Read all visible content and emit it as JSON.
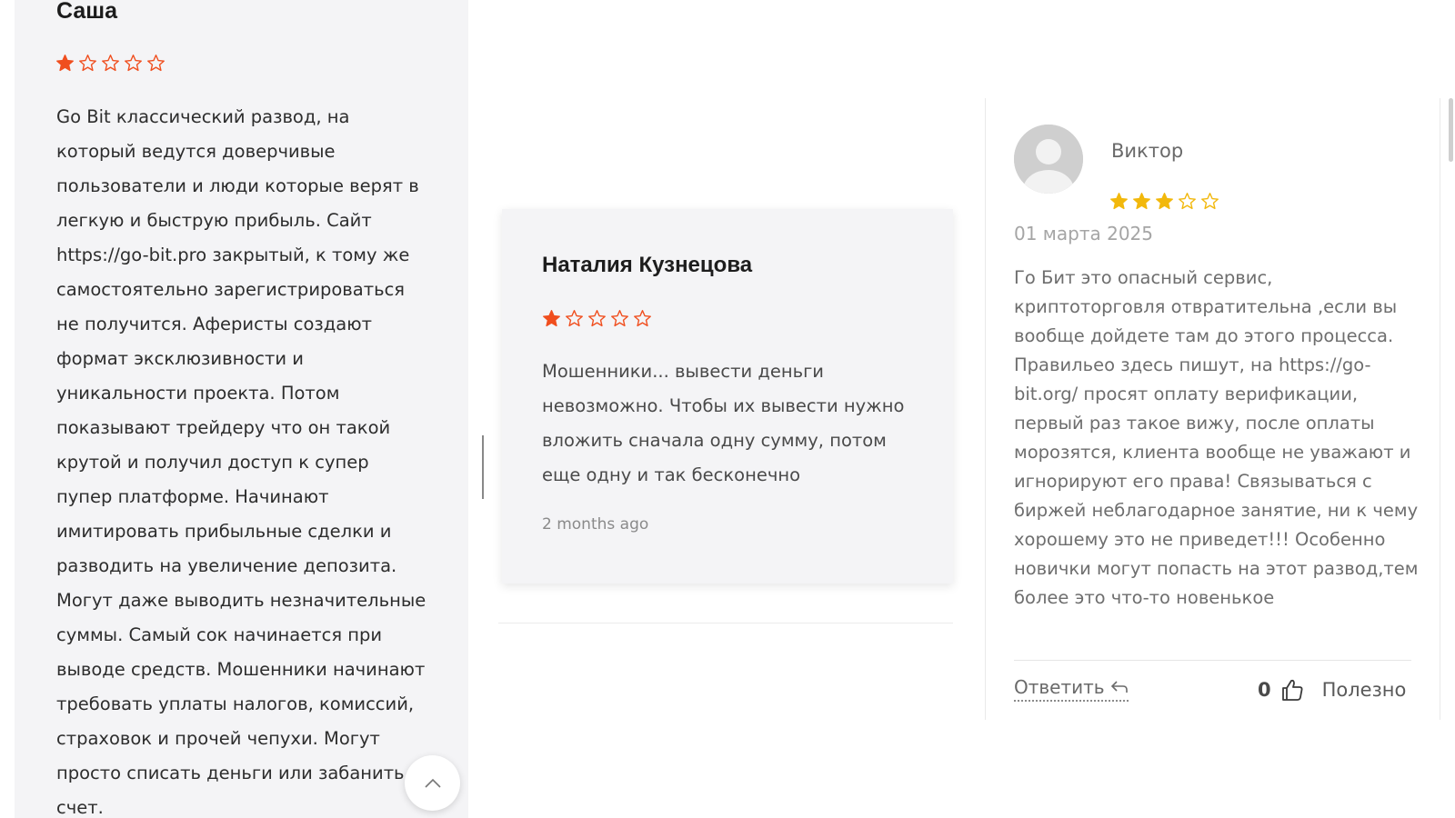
{
  "colors": {
    "star_orange": "#f04e1e",
    "star_gold": "#f2b80c",
    "card_bg": "#f4f4f6"
  },
  "review_left": {
    "author": "Саша",
    "rating": 1,
    "rating_max": 5,
    "text": "Go Bit классический развод, на который ведутся доверчивые пользователи и люди которые верят в легкую и быструю прибыль. Сайт https://go-bit.pro закрытый, к тому же самостоятельно зарегистрироваться не получится. Аферисты создают формат эксклюзивности и уникальности проекта. Потом показывают трейдеру что он такой крутой и получил доступ к супер пупер платформе. Начинают имитировать прибыльные сделки и разводить на увеличение депозита. Могут даже выводить незначительные суммы. Самый сок начинается при выводе средств. Мошенники начинают требовать уплаты налогов, комиссий, страховок и прочей чепухи. Могут просто списать деньги или забанить счет."
  },
  "review_middle": {
    "author": "Наталия Кузнецова",
    "rating": 1,
    "rating_max": 5,
    "text": "Мошенники... вывести деньги невозможно. Чтобы их вывести нужно вложить сначала одну сумму, потом еще одну и так бесконечно",
    "time_ago": "2 months ago"
  },
  "review_right": {
    "author": "Виктор",
    "rating": 3,
    "rating_max": 5,
    "date": "01 марта 2025",
    "text": "Го Бит это опасный сервис, криптоторговля отвратительна ,если вы вообще дойдете там до этого процесса. Правильео здесь пишут, на https://go-bit.org/ просят оплату верификации, первый раз такое вижу, после оплаты морозятся, клиента вообще не уважают и игнорируют его права! Связываться с биржей неблагодарное занятие, ни к чему хорошему это не приведет!!! Особенно новички могут попасть на этот развод,тем более это что-то новенькое",
    "reply_label": "Ответить",
    "likes_count": "0",
    "useful_label": "Полезно"
  },
  "icons": {
    "scroll_top": "chevron-up-icon",
    "reply": "reply-arrow-icon",
    "like": "thumbs-up-icon",
    "avatar": "user-placeholder-icon"
  }
}
